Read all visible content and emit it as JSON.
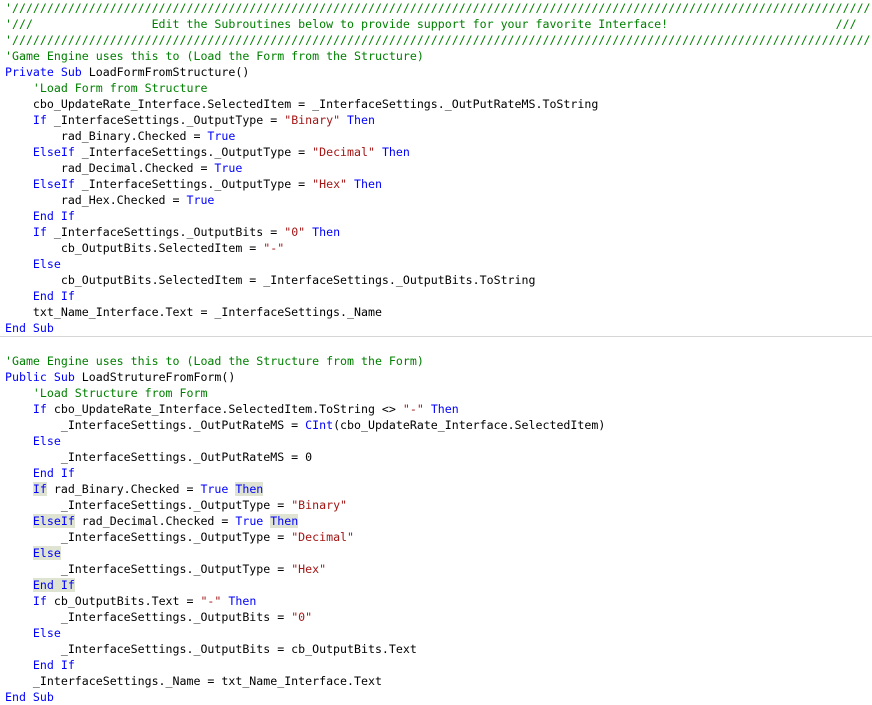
{
  "editor": {
    "language": "Visual Basic",
    "colors": {
      "comment": "#008000",
      "keyword": "#0000ff",
      "string": "#a31515",
      "highlight": "#dfe3d2"
    },
    "separator_before_line": 21,
    "lines": [
      [
        [
          "c",
          "'///////////////////////////////////////////////////////////////////////////////////////////////////////////////////////////"
        ]
      ],
      [
        [
          "c",
          "'///                 Edit the Subroutines below to provide support for your favorite Interface!                        ///"
        ]
      ],
      [
        [
          "c",
          "'///////////////////////////////////////////////////////////////////////////////////////////////////////////////////////////"
        ]
      ],
      [
        [
          "c",
          "'Game Engine uses this to (Load the Form from the Structure)"
        ]
      ],
      [
        [
          "k",
          "Private Sub"
        ],
        [
          "p",
          " LoadFormFromStructure()"
        ]
      ],
      [
        [
          "p",
          "    "
        ],
        [
          "c",
          "'Load Form from Structure"
        ]
      ],
      [
        [
          "p",
          "    cbo_UpdateRate_Interface.SelectedItem = _InterfaceSettings._OutPutRateMS.ToString"
        ]
      ],
      [
        [
          "p",
          "    "
        ],
        [
          "k",
          "If"
        ],
        [
          "p",
          " _InterfaceSettings._OutputType = "
        ],
        [
          "s",
          "\"Binary\""
        ],
        [
          "p",
          " "
        ],
        [
          "k",
          "Then"
        ]
      ],
      [
        [
          "p",
          "        rad_Binary.Checked = "
        ],
        [
          "k",
          "True"
        ]
      ],
      [
        [
          "p",
          "    "
        ],
        [
          "k",
          "ElseIf"
        ],
        [
          "p",
          " _InterfaceSettings._OutputType = "
        ],
        [
          "s",
          "\"Decimal\""
        ],
        [
          "p",
          " "
        ],
        [
          "k",
          "Then"
        ]
      ],
      [
        [
          "p",
          "        rad_Decimal.Checked = "
        ],
        [
          "k",
          "True"
        ]
      ],
      [
        [
          "p",
          "    "
        ],
        [
          "k",
          "ElseIf"
        ],
        [
          "p",
          " _InterfaceSettings._OutputType = "
        ],
        [
          "s",
          "\"Hex\""
        ],
        [
          "p",
          " "
        ],
        [
          "k",
          "Then"
        ]
      ],
      [
        [
          "p",
          "        rad_Hex.Checked = "
        ],
        [
          "k",
          "True"
        ]
      ],
      [
        [
          "p",
          "    "
        ],
        [
          "k",
          "End If"
        ]
      ],
      [
        [
          "p",
          "    "
        ],
        [
          "k",
          "If"
        ],
        [
          "p",
          " _InterfaceSettings._OutputBits = "
        ],
        [
          "s",
          "\"0\""
        ],
        [
          "p",
          " "
        ],
        [
          "k",
          "Then"
        ]
      ],
      [
        [
          "p",
          "        cb_OutputBits.SelectedItem = "
        ],
        [
          "s",
          "\"-\""
        ]
      ],
      [
        [
          "p",
          "    "
        ],
        [
          "k",
          "Else"
        ]
      ],
      [
        [
          "p",
          "        cb_OutputBits.SelectedItem = _InterfaceSettings._OutputBits.ToString"
        ]
      ],
      [
        [
          "p",
          "    "
        ],
        [
          "k",
          "End If"
        ]
      ],
      [
        [
          "p",
          "    txt_Name_Interface.Text = _InterfaceSettings._Name"
        ]
      ],
      [
        [
          "k",
          "End Sub"
        ]
      ],
      [],
      [
        [
          "c",
          "'Game Engine uses this to (Load the Structure from the Form)"
        ]
      ],
      [
        [
          "k",
          "Public Sub"
        ],
        [
          "p",
          " LoadStrutureFromForm()"
        ]
      ],
      [
        [
          "p",
          "    "
        ],
        [
          "c",
          "'Load Structure from Form"
        ]
      ],
      [
        [
          "p",
          "    "
        ],
        [
          "k",
          "If"
        ],
        [
          "p",
          " cbo_UpdateRate_Interface.SelectedItem.ToString <> "
        ],
        [
          "s",
          "\"-\""
        ],
        [
          "p",
          " "
        ],
        [
          "k",
          "Then"
        ]
      ],
      [
        [
          "p",
          "        _InterfaceSettings._OutPutRateMS = "
        ],
        [
          "k",
          "CInt"
        ],
        [
          "p",
          "(cbo_UpdateRate_Interface.SelectedItem)"
        ]
      ],
      [
        [
          "p",
          "    "
        ],
        [
          "k",
          "Else"
        ]
      ],
      [
        [
          "p",
          "        _InterfaceSettings._OutPutRateMS = 0"
        ]
      ],
      [
        [
          "p",
          "    "
        ],
        [
          "k",
          "End If"
        ]
      ],
      [
        [
          "p",
          "    "
        ],
        [
          "h",
          "If"
        ],
        [
          "p",
          " rad_Binary.Checked = "
        ],
        [
          "k",
          "True"
        ],
        [
          "p",
          " "
        ],
        [
          "h",
          "Then"
        ]
      ],
      [
        [
          "p",
          "        _InterfaceSettings._OutputType = "
        ],
        [
          "s",
          "\"Binary\""
        ]
      ],
      [
        [
          "p",
          "    "
        ],
        [
          "h",
          "ElseIf"
        ],
        [
          "p",
          " rad_Decimal.Checked = "
        ],
        [
          "k",
          "True"
        ],
        [
          "p",
          " "
        ],
        [
          "h",
          "Then"
        ]
      ],
      [
        [
          "p",
          "        _InterfaceSettings._OutputType = "
        ],
        [
          "s",
          "\"Decimal\""
        ]
      ],
      [
        [
          "p",
          "    "
        ],
        [
          "h",
          "Else"
        ]
      ],
      [
        [
          "p",
          "        _InterfaceSettings._OutputType = "
        ],
        [
          "s",
          "\"Hex\""
        ]
      ],
      [
        [
          "p",
          "    "
        ],
        [
          "h",
          "End If"
        ]
      ],
      [
        [
          "p",
          "    "
        ],
        [
          "k",
          "If"
        ],
        [
          "p",
          " cb_OutputBits.Text = "
        ],
        [
          "s",
          "\"-\""
        ],
        [
          "p",
          " "
        ],
        [
          "k",
          "Then"
        ]
      ],
      [
        [
          "p",
          "        _InterfaceSettings._OutputBits = "
        ],
        [
          "s",
          "\"0\""
        ]
      ],
      [
        [
          "p",
          "    "
        ],
        [
          "k",
          "Else"
        ]
      ],
      [
        [
          "p",
          "        _InterfaceSettings._OutputBits = cb_OutputBits.Text"
        ]
      ],
      [
        [
          "p",
          "    "
        ],
        [
          "k",
          "End If"
        ]
      ],
      [
        [
          "p",
          "    _InterfaceSettings._Name = txt_Name_Interface.Text"
        ]
      ],
      [
        [
          "k",
          "End Sub"
        ]
      ]
    ]
  }
}
